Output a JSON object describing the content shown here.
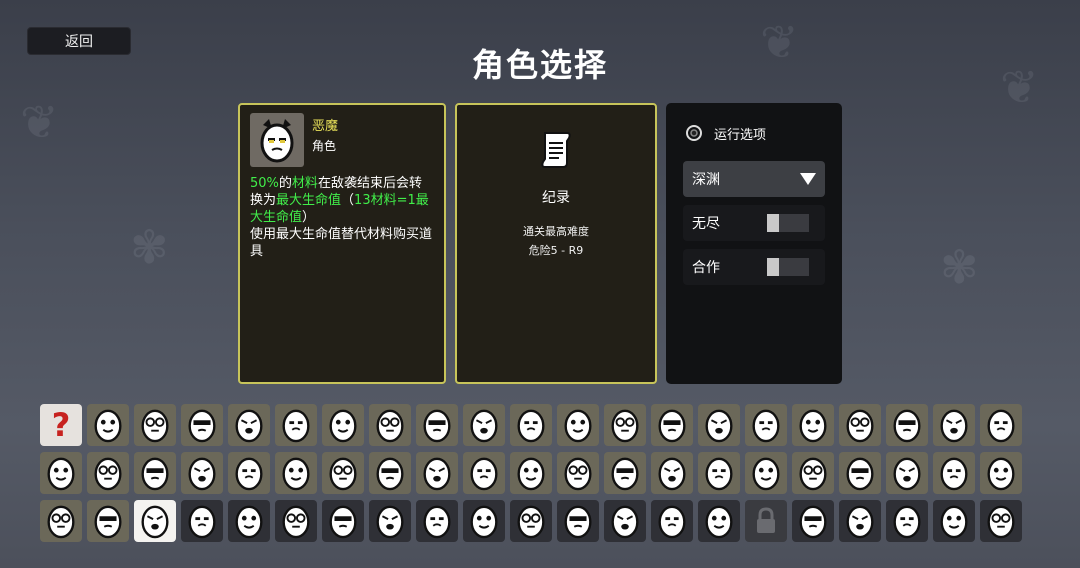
{
  "header": {
    "back_label": "返回",
    "title": "角色选择"
  },
  "character": {
    "name": "恶魔",
    "type": "角色",
    "desc1_highlight": "50%",
    "desc1_a": "的",
    "desc1_hl2": "材料",
    "desc1_b": "在敌袭结束后会转换为",
    "desc1_hl3": "最大生命值",
    "desc1_c": "（",
    "desc1_hl4": "13材料=1最大生命值",
    "desc1_d": "）",
    "desc2": "使用最大生命值替代材料购买道具"
  },
  "record": {
    "title": "纪录",
    "subtitle": "通关最高难度",
    "value": "危险5 - R9"
  },
  "options": {
    "title": "运行选项",
    "dropdown_value": "深渊",
    "endless_label": "无尽",
    "endless_on": false,
    "coop_label": "合作",
    "coop_on": false
  },
  "grid": {
    "columns": 21,
    "selected_index": 44,
    "locked_index": 57,
    "random_index": 0
  },
  "colors": {
    "accent_yellow": "#e9e25a",
    "highlight_green": "#41ee4a",
    "panel_border": "#c7c45a"
  }
}
